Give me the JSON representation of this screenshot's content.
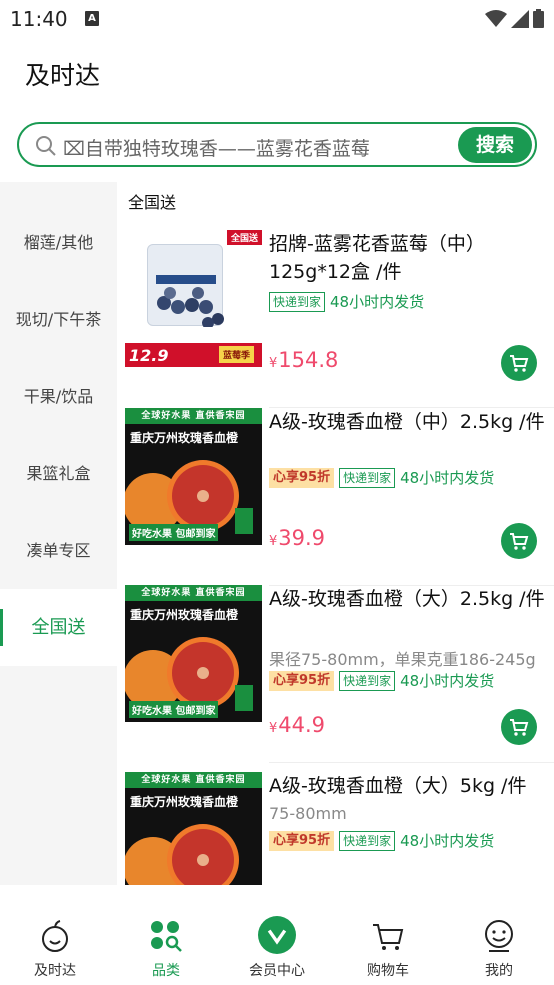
{
  "status_bar": {
    "time": "11:40",
    "app_icon_letter": "A"
  },
  "header": {
    "title": "及时达"
  },
  "search": {
    "placeholder": "⌧自带独特玫瑰香——蓝雾花香蓝莓",
    "button_label": "搜索"
  },
  "sidebar": {
    "items": [
      {
        "label": "榴莲/其他",
        "active": false
      },
      {
        "label": "现切/下午茶",
        "active": false
      },
      {
        "label": "干果/饮品",
        "active": false
      },
      {
        "label": "果篮礼盒",
        "active": false
      },
      {
        "label": "凑单专区",
        "active": false
      },
      {
        "label": "全国送",
        "active": true
      }
    ]
  },
  "content": {
    "section_title": "全国送",
    "products": [
      {
        "name": "招牌-蓝雾花香蓝莓（中）125g*12盒 /件",
        "spec": "",
        "discount_tag": "",
        "delivery_tag": "快递到家",
        "ship_text": "48小时内发货",
        "currency": "¥",
        "price": "154.8",
        "image": {
          "kind": "blueberry",
          "corner": "全国送",
          "big_text": "12.9",
          "sticker": "蓝莓季"
        }
      },
      {
        "name": "A级-玫瑰香血橙（中）2.5kg /件",
        "spec": "",
        "discount_tag": "心享95折",
        "delivery_tag": "快递到家",
        "ship_text": "48小时内发货",
        "currency": "¥",
        "price": "39.9",
        "image": {
          "kind": "orange",
          "banner": "全球好水果 直供香宋园",
          "headline": "重庆万州玫瑰香血橙",
          "bottom": "好吃水果 包邮到家"
        }
      },
      {
        "name": "A级-玫瑰香血橙（大）2.5kg /件",
        "spec": "果径75-80mm，单果克重186-245g",
        "discount_tag": "心享95折",
        "delivery_tag": "快递到家",
        "ship_text": "48小时内发货",
        "currency": "¥",
        "price": "44.9",
        "image": {
          "kind": "orange",
          "banner": "全球好水果 直供香宋园",
          "headline": "重庆万州玫瑰香血橙",
          "bottom": "好吃水果 包邮到家"
        }
      },
      {
        "name": "A级-玫瑰香血橙（大）5kg /件",
        "spec": "75-80mm",
        "discount_tag": "心享95折",
        "delivery_tag": "快递到家",
        "ship_text": "48小时内发货",
        "currency": "",
        "price": "",
        "image": {
          "kind": "orange",
          "banner": "全球好水果 直供香宋园",
          "headline": "重庆万州玫瑰香血橙",
          "bottom": ""
        }
      }
    ]
  },
  "bottom_nav": {
    "items": [
      {
        "label": "及时达",
        "icon": "apple-icon",
        "active": false
      },
      {
        "label": "品类",
        "icon": "category-icon",
        "active": true
      },
      {
        "label": "会员中心",
        "icon": "member-icon",
        "active": false
      },
      {
        "label": "购物车",
        "icon": "cart-icon",
        "active": false
      },
      {
        "label": "我的",
        "icon": "profile-icon",
        "active": false
      }
    ]
  },
  "colors": {
    "brand_green": "#1a9a52",
    "price_pink": "#ef4a6c",
    "discount_bg": "#fde0a4"
  }
}
